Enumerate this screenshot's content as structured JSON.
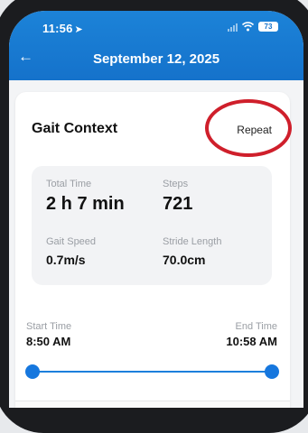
{
  "status_bar": {
    "time": "11:56",
    "location_icon": "location-arrow-icon",
    "battery": "73"
  },
  "header": {
    "back_icon": "back-arrow-icon",
    "title": "September 12, 2025"
  },
  "card": {
    "title": "Gait Context",
    "repeat_label": "Repeat",
    "stats": [
      {
        "label": "Total Time",
        "value": "2 h 7 min"
      },
      {
        "label": "Steps",
        "value": "721"
      },
      {
        "label": "Gait Speed",
        "value": "0.7m/s"
      },
      {
        "label": "Stride Length",
        "value": "70.0cm"
      }
    ],
    "time_range": {
      "start_label": "Start Time",
      "start_value": "8:50 AM",
      "end_label": "End Time",
      "end_value": "10:58 AM"
    }
  },
  "colors": {
    "header_blue": "#1572cb",
    "slider_blue": "#1677de",
    "annotation_red": "#cf1f2b"
  }
}
